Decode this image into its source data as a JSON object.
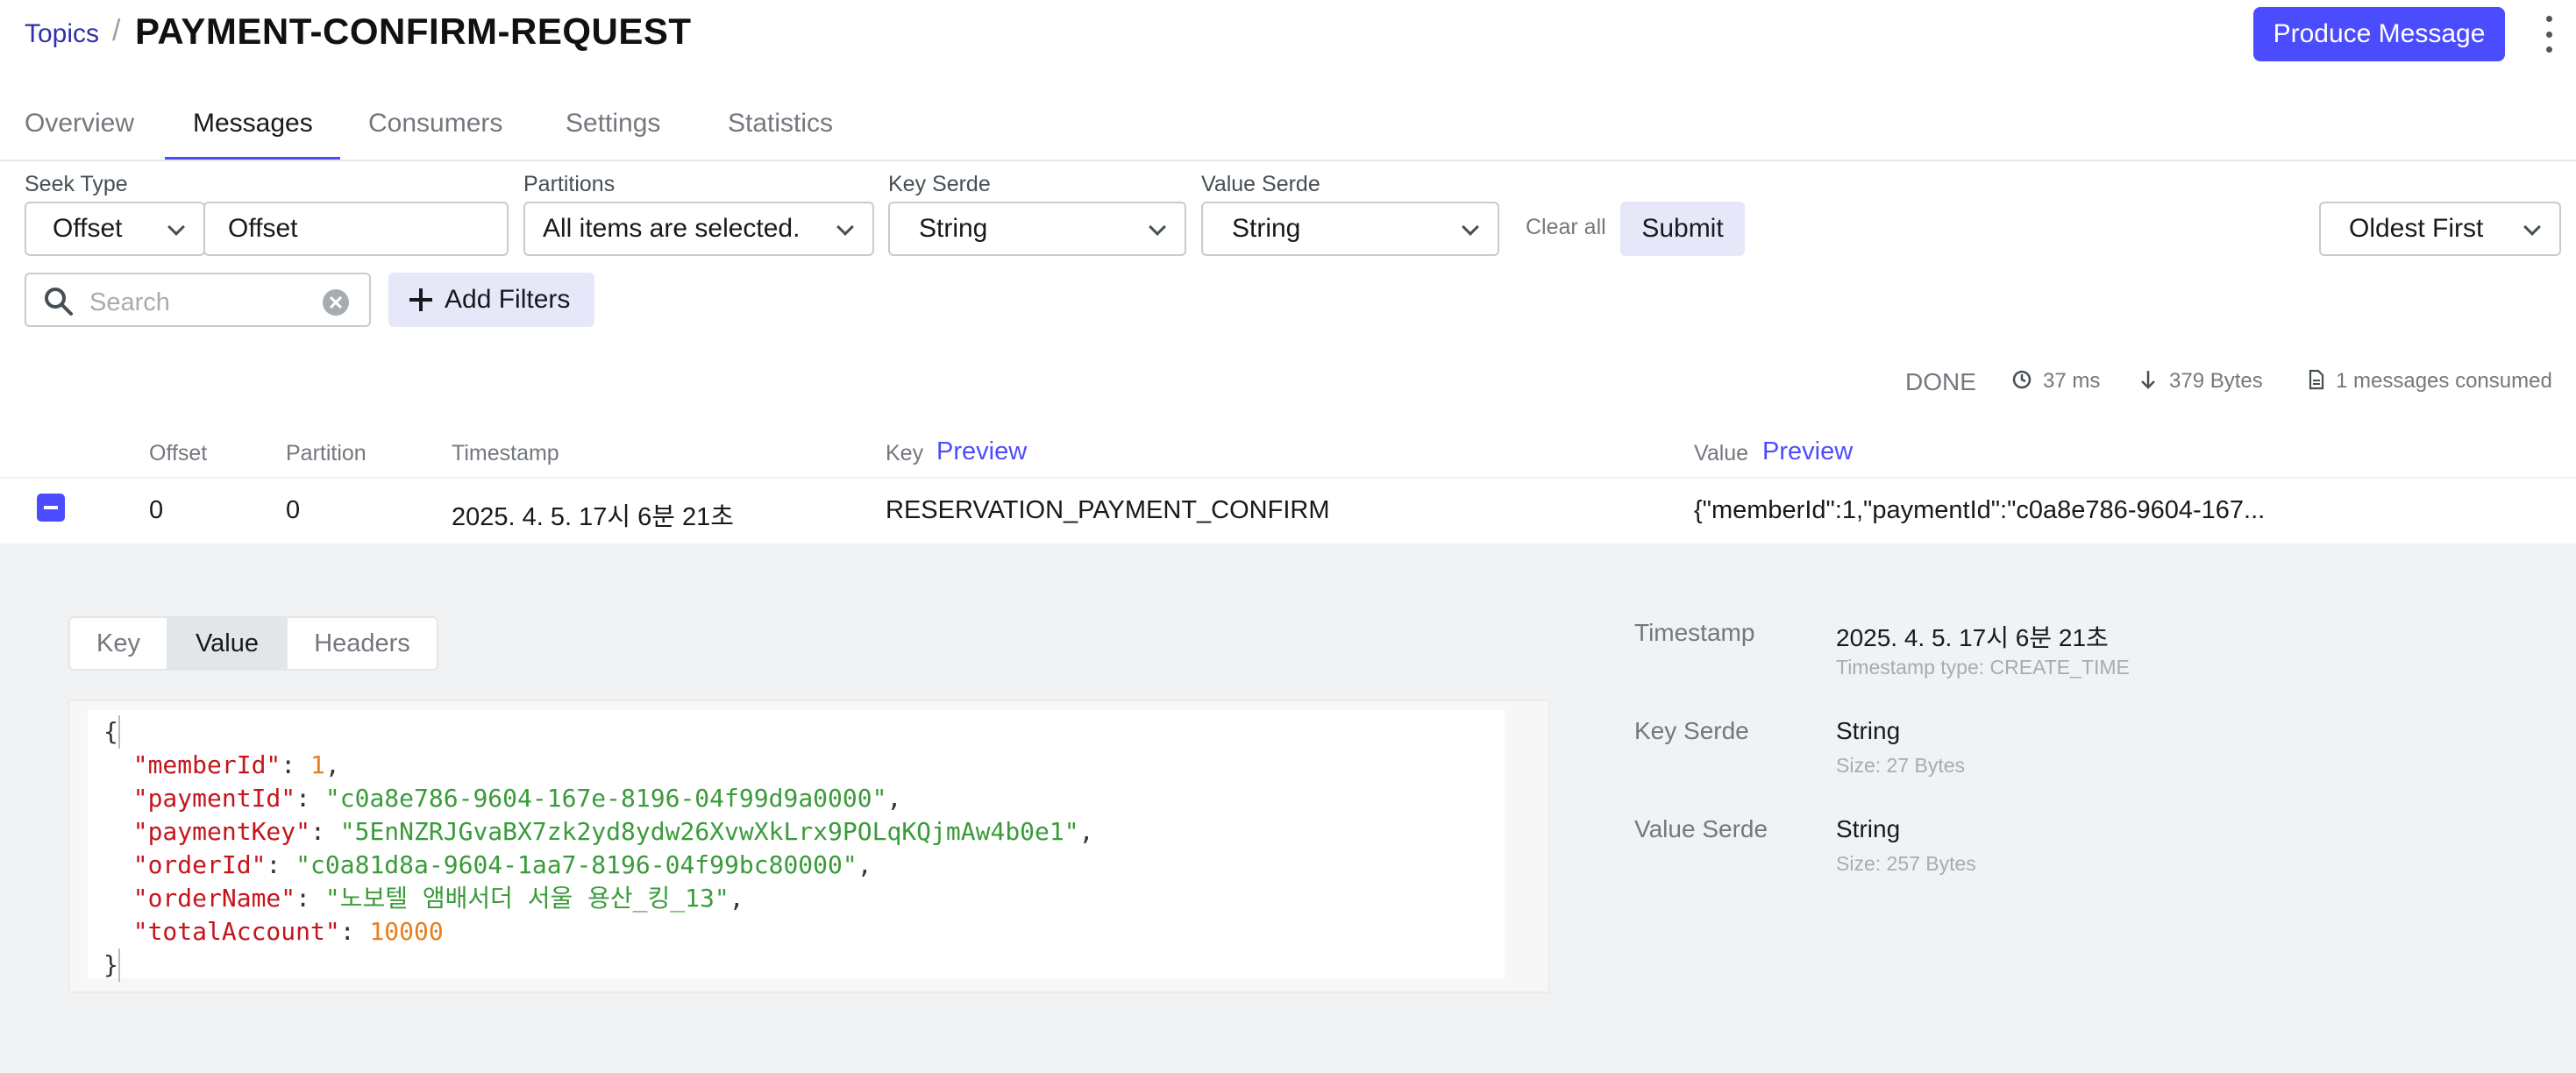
{
  "breadcrumb": {
    "parent": "Topics",
    "separator": "/",
    "title": "PAYMENT-CONFIRM-REQUEST"
  },
  "header": {
    "produce_label": "Produce Message"
  },
  "tabs": [
    {
      "label": "Overview"
    },
    {
      "label": "Messages"
    },
    {
      "label": "Consumers"
    },
    {
      "label": "Settings"
    },
    {
      "label": "Statistics"
    }
  ],
  "filters": {
    "seek_type_label": "Seek Type",
    "seek_type_value": "Offset",
    "seek_input_value": "Offset",
    "partitions_label": "Partitions",
    "partitions_value": "All items are selected.",
    "key_serde_label": "Key Serde",
    "key_serde_value": "String",
    "value_serde_label": "Value Serde",
    "value_serde_value": "String",
    "clear_all": "Clear all",
    "submit": "Submit",
    "sort_value": "Oldest First",
    "search_placeholder": "Search",
    "add_filters": "Add Filters"
  },
  "status": {
    "state": "DONE",
    "elapsed": "37 ms",
    "bytes": "379 Bytes",
    "consumed": "1 messages consumed"
  },
  "table": {
    "headers": {
      "offset": "Offset",
      "partition": "Partition",
      "timestamp": "Timestamp",
      "key": "Key",
      "value": "Value",
      "preview": "Preview"
    },
    "rows": [
      {
        "offset": "0",
        "partition": "0",
        "timestamp": "2025. 4. 5. 17시 6분 21초",
        "key": "RESERVATION_PAYMENT_CONFIRM",
        "value": "{\"memberId\":1,\"paymentId\":\"c0a8e786-9604-167..."
      }
    ]
  },
  "detail": {
    "tabs": [
      "Key",
      "Value",
      "Headers"
    ],
    "json": {
      "open": "{",
      "close": "}",
      "lines": [
        {
          "key": "\"memberId\"",
          "value": "1",
          "type": "number"
        },
        {
          "key": "\"paymentId\"",
          "value": "\"c0a8e786-9604-167e-8196-04f99d9a0000\"",
          "type": "string"
        },
        {
          "key": "\"paymentKey\"",
          "value": "\"5EnNZRJGvaBX7zk2yd8ydw26XvwXkLrx9POLqKQjmAw4b0e1\"",
          "type": "string"
        },
        {
          "key": "\"orderId\"",
          "value": "\"c0a81d8a-9604-1aa7-8196-04f99bc80000\"",
          "type": "string"
        },
        {
          "key": "\"orderName\"",
          "value": "\"노보텔 앰배서더 서울 용산_킹_13\"",
          "type": "string"
        },
        {
          "key": "\"totalAccount\"",
          "value": "10000",
          "type": "number"
        }
      ]
    },
    "meta": {
      "timestamp_label": "Timestamp",
      "timestamp_value": "2025. 4. 5. 17시 6분 21초",
      "timestamp_sub": "Timestamp type: CREATE_TIME",
      "key_serde_label": "Key Serde",
      "key_serde_value": "String",
      "key_serde_sub": "Size: 27 Bytes",
      "value_serde_label": "Value Serde",
      "value_serde_value": "String",
      "value_serde_sub": "Size: 257 Bytes"
    }
  },
  "colors": {
    "accent": "#4c4cff",
    "json_key": "#c4151c",
    "json_string": "#3a9b3a",
    "json_number": "#e67e22"
  }
}
